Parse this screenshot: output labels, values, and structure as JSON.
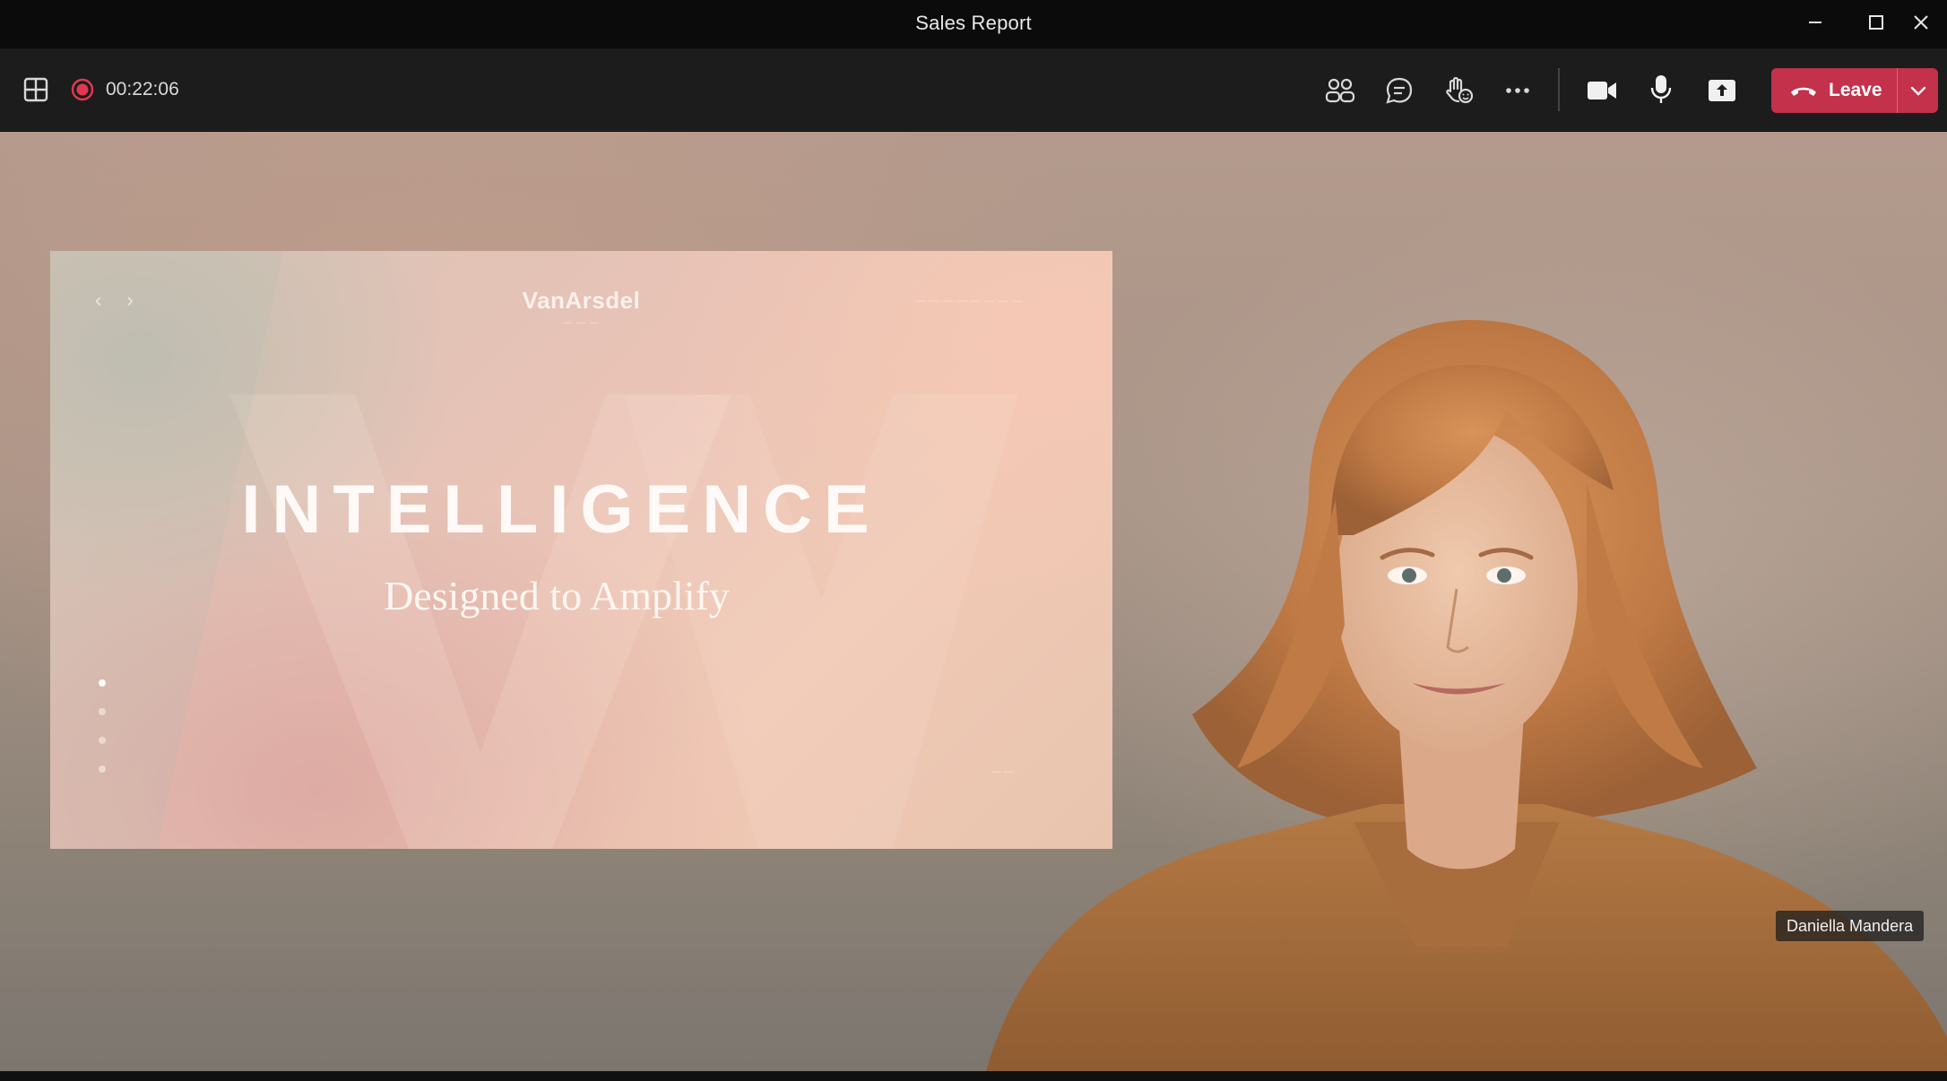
{
  "window": {
    "title": "Sales Report"
  },
  "toolbar": {
    "recording_time": "00:22:06",
    "leave_label": "Leave"
  },
  "slide": {
    "brand": "VanArsdel",
    "headline": "INTELLIGENCE",
    "subheadline": "Designed to Amplify",
    "slide_dots": 4,
    "active_dot": 0
  },
  "presenter": {
    "name": "Daniella Mandera"
  },
  "colors": {
    "leave_button": "#c4314b",
    "record_indicator": "#e0394f"
  }
}
